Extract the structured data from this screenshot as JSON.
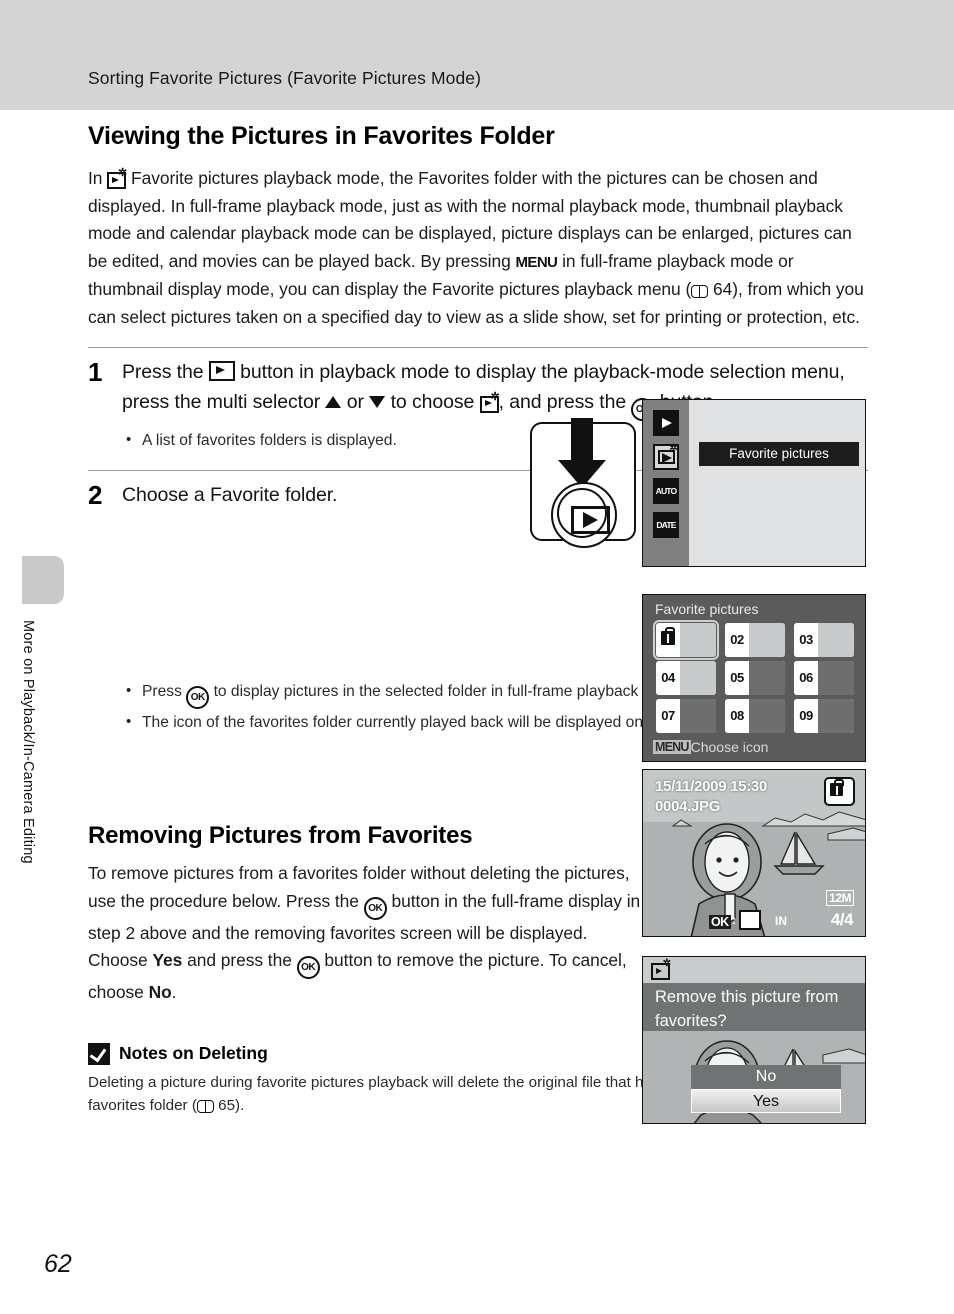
{
  "header": {
    "running_title": "Sorting Favorite Pictures (Favorite Pictures Mode)"
  },
  "sidebar": {
    "chapter_label": "More on Playback/In-Camera Editing"
  },
  "page": {
    "number": "62"
  },
  "section1": {
    "title": "Viewing the Pictures in Favorites Folder",
    "intro_p1": "In",
    "intro_p2": "Favorite pictures playback mode, the Favorites folder with the pictures can be chosen and displayed. In full-frame playback mode, just as with the normal playback mode, thumbnail playback mode and calendar playback mode can be displayed, picture displays can be enlarged, pictures can be edited, and movies can be played back. By pressing",
    "intro_p3": "in full-frame playback mode or thumbnail display mode, you can display the Favorite pictures playback menu (",
    "intro_page_ref": "64",
    "intro_p4": "), from which you can select pictures taken on a specified day to view as a slide show, set for printing or protection, etc."
  },
  "steps": [
    {
      "number": "1",
      "text_a": "Press the",
      "text_b": "button in playback mode to display the playback-mode selection menu, press the multi selector",
      "text_c": "or",
      "text_d": "to choose",
      "text_e": ", and press the",
      "text_f": "button.",
      "bullets": [
        "A list of favorites folders is displayed."
      ]
    },
    {
      "number": "2",
      "text_a": "Choose a Favorite folder.",
      "bullets": [
        {
          "a": "Press",
          "b": "to display pictures in the selected folder in full-frame playback mode."
        },
        {
          "a": "",
          "b": "The icon of the favorites folder currently played back will be displayed on the top right of the screen."
        }
      ]
    }
  ],
  "lcd_mode_select": {
    "selected_label": "Favorite pictures",
    "icons": [
      "playback-icon",
      "favorite-pictures-icon",
      "auto-sort-icon",
      "list-by-date-icon"
    ],
    "icon_text": {
      "auto": "AUTO",
      "date": "DATE"
    }
  },
  "lcd_folder_list": {
    "title": "Favorite pictures",
    "footer_chip": "MENU",
    "footer_text": "Choose icon",
    "folders": [
      {
        "num": "",
        "icon": "shopping-bag-icon",
        "has_image": true,
        "selected": true
      },
      {
        "num": "02",
        "icon": "",
        "has_image": true,
        "selected": false
      },
      {
        "num": "03",
        "icon": "",
        "has_image": true,
        "selected": false
      },
      {
        "num": "04",
        "icon": "",
        "has_image": true,
        "selected": false
      },
      {
        "num": "05",
        "icon": "",
        "has_image": false,
        "selected": false
      },
      {
        "num": "06",
        "icon": "",
        "has_image": false,
        "selected": false
      },
      {
        "num": "07",
        "icon": "",
        "has_image": false,
        "selected": false
      },
      {
        "num": "08",
        "icon": "",
        "has_image": false,
        "selected": false
      },
      {
        "num": "09",
        "icon": "",
        "has_image": false,
        "selected": false
      }
    ]
  },
  "lcd_full_frame": {
    "datetime": "15/11/2009 15:30",
    "filename": "0004.JPG",
    "image_size": "12M",
    "frame_counter": "4/",
    "frame_total": "4",
    "ok_label": "OK",
    "colon": ":",
    "memory_label": "IN"
  },
  "lcd_remove": {
    "question": "Remove this picture from favorites?",
    "option_no": "No",
    "option_yes": "Yes"
  },
  "section2": {
    "title": "Removing Pictures from Favorites",
    "p1": "To remove pictures from a favorites folder without deleting the pictures, use the procedure below. Press the",
    "p2": "button in the full-frame display in step 2 above and the removing favorites screen will be displayed. Choose",
    "bold_yes": "Yes",
    "p3": "and press the",
    "p4": "button to remove the picture. To cancel, choose",
    "bold_no": "No",
    "p5": "."
  },
  "note": {
    "title": "Notes on Deleting",
    "body_a": "Deleting a picture during favorite pictures playback will delete the original file that has been registered to the favorites folder (",
    "page_ref": "65",
    "body_b": ")."
  },
  "colors": {
    "header_band": "#d4d4d4",
    "sidebar_tab": "#c9c9c9",
    "lcd_dark": "#5b5b5b",
    "lcd_light": "#dfe1e2",
    "highlight_bar": "#1d1d1d"
  }
}
